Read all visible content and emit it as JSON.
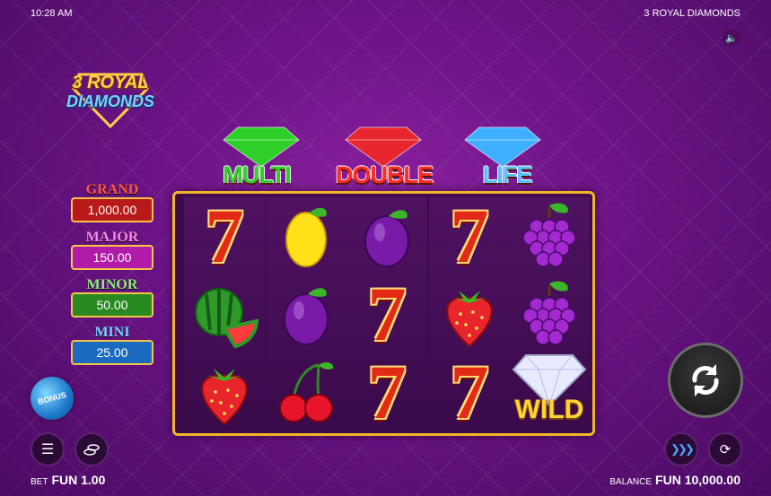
{
  "status": {
    "time": "10:28 AM",
    "game_title": "3 ROYAL DIAMONDS"
  },
  "logo": {
    "line1": "3 ROYAL",
    "line2": "DIAMONDS"
  },
  "jackpots": [
    {
      "label": "GRAND",
      "value": "1,000.00",
      "label_color": "#ff5a3c",
      "bg": "#b81a1a"
    },
    {
      "label": "MAJOR",
      "value": "150.00",
      "label_color": "#ff8ae6",
      "bg": "#b21aa8"
    },
    {
      "label": "MINOR",
      "value": "50.00",
      "label_color": "#8ef07a",
      "bg": "#2a8a22"
    },
    {
      "label": "MINI",
      "value": "25.00",
      "label_color": "#7ad0ff",
      "bg": "#1a6ac0"
    }
  ],
  "gems": [
    {
      "label": "MULTI",
      "color": "#2fcf2a",
      "label_color": "#2fd02a"
    },
    {
      "label": "DOUBLE",
      "color": "#e8262e",
      "label_color": "#ff2a2a"
    },
    {
      "label": "LIFE",
      "color": "#3fb0ff",
      "label_color": "#58c0ff"
    }
  ],
  "reels": [
    [
      "seven",
      "watermelon",
      "strawberry"
    ],
    [
      "lemon",
      "plum",
      "cherries"
    ],
    [
      "plum",
      "seven",
      "seven"
    ],
    [
      "seven",
      "strawberry",
      "seven"
    ],
    [
      "grapes",
      "grapes",
      "wild"
    ]
  ],
  "wild_label": "WILD",
  "bonus_label": "BONUS",
  "footer": {
    "bet_label": "BET",
    "bet_value": "FUN 1.00",
    "balance_label": "BALANCE",
    "balance_value": "FUN 10,000.00"
  },
  "icons": {
    "sound": "speaker-icon",
    "menu": "menu-icon",
    "coins": "coins-icon",
    "spin": "spin-icon",
    "turbo": "fast-forward-icon",
    "autoplay": "autoplay-icon"
  }
}
